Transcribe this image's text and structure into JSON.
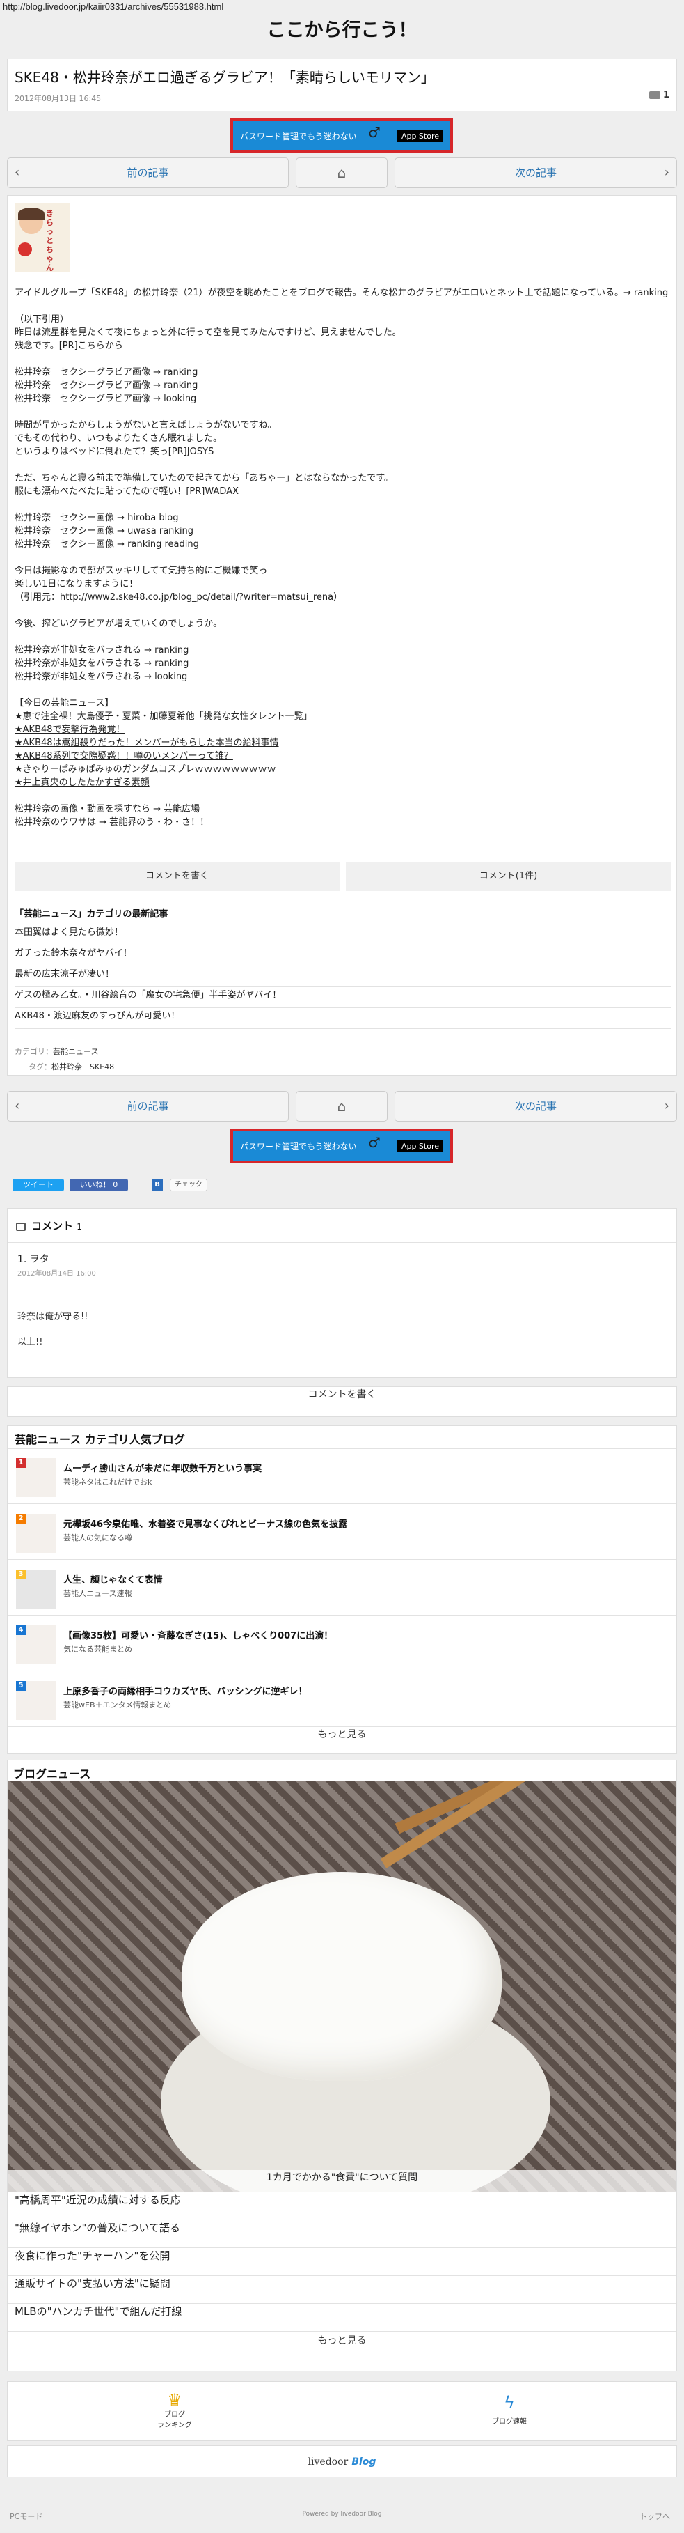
{
  "url": "http://blog.livedoor.jp/kaiir0331/archives/55531988.html",
  "site_title": "ここから行こう！",
  "post": {
    "title": "SKE48・松井玲奈がエロ過ぎるグラビア！「素晴らしいモリマン」",
    "date": "2012年08月13日 16:45",
    "comment_count": "1"
  },
  "banner": {
    "text": "パスワード管理でもう迷わない",
    "store": " App Store"
  },
  "nav": {
    "prev": "前の記事",
    "next": "次の記事"
  },
  "article": {
    "thumb_text": "きらっとちゃん",
    "lines": [
      "アイドルグループ「SKE48」の松井玲奈（21）が夜空を眺めたことをブログで報告。そんな松井のグラビアがエロいとネット上で話題になっている。→ ranking",
      "",
      "（以下引用）",
      "昨日は流星群を見たくて夜にちょっと外に行って空を見てみたんですけど、見えませんでした。",
      "残念です。[PR]こちらから",
      "",
      "松井玲奈　セクシーグラビア画像 → ranking",
      "松井玲奈　セクシーグラビア画像 → ranking",
      "松井玲奈　セクシーグラビア画像 → looking",
      "",
      "時間が早かったからしょうがないと言えばしょうがないですね。",
      "でもその代わり、いつもよりたくさん眠れました。",
      "というよりはベッドに倒れたて？笑っ[PR]JOSYS",
      "",
      "ただ、ちゃんと寝る前まで準備していたので起きてから「あちゃー」とはならなかったです。",
      "服にも漂布べたべたに貼ってたので軽い！[PR]WADAX",
      "",
      "松井玲奈　セクシー画像 → hiroba blog",
      "松井玲奈　セクシー画像 → uwasa ranking",
      "松井玲奈　セクシー画像 → ranking reading",
      "",
      "今日は撮影なので部がスッキリしてて気持ち的にご機嫌で笑っ",
      "楽しい1日になりますように！",
      "（引用元：http://www2.ske48.co.jp/blog_pc/detail/?writer=matsui_rena）",
      "",
      "今後、搾どいグラビアが増えていくのでしょうか。",
      "",
      "松井玲奈が非処女をバラされる → ranking",
      "松井玲奈が非処女をバラされる → ranking",
      "松井玲奈が非処女をバラされる → looking",
      "",
      "【今日の芸能ニュース】",
      "★恵で注全裸！大島優子・夏菜・加藤夏希他「挑発な女性タレント一覧」",
      "★AKB48で妄撃行為発覚！",
      "★AKB48は嵩組殺りだった！メンバーがもらした本当の給料事情",
      "★AKB48系列で交際疑惑！！噂のいメンバーって誰？",
      "★きゃりーぱみゅぱみゅのガンダムコスプレｗｗｗｗｗｗｗｗｗ",
      "★井上真央のしたたかすぎる素顔",
      "",
      "松井玲奈の画像・動画を探すなら → 芸能広場",
      "松井玲奈のウワサは → 芸能界のう・わ・さ！！"
    ]
  },
  "comment_bar": {
    "write": "コメントを書く",
    "count": "コメント(1件)"
  },
  "related": {
    "heading": "「芸能ニュース」カテゴリの最新記事",
    "items": [
      "本田翼はよく見たら微妙！",
      "ガチった鈴木奈々がヤバイ！",
      "最新の広末涼子が凄い！",
      "ゲスの極み乙女。・川谷絵音の「魔女の宅急便」半手姿がヤバイ！",
      "AKB48・渡辺麻友のすっぴんが可愛い！"
    ]
  },
  "meta": {
    "category_label": "カテゴリ：",
    "category": "芸能ニュース",
    "tag_label": "タグ：",
    "tags": "松井玲奈　SKE48"
  },
  "social": {
    "tweet": "ツイート",
    "like": "いいね！ 0",
    "check": "チェック"
  },
  "comments": {
    "heading": "コメント",
    "count": "1",
    "author": "1. ヲタ",
    "date": "2012年08月14日 16:00",
    "body1": "玲奈は俺が守る!!",
    "body2": "以上!!",
    "write": "コメントを書く"
  },
  "ranking": {
    "heading": "芸能ニュース カテゴリ人気ブログ",
    "items": [
      {
        "num": "1",
        "title": "ムーディ勝山さんが未だに年収数千万という事実",
        "sub": "芸能ネタはこれだけでおk",
        "color": "#d32f2f"
      },
      {
        "num": "2",
        "title": "元欅坂46今泉佑唯、水着姿で見事なくびれとビーナス線の色気を披露",
        "sub": "芸能人の気になる噂",
        "color": "#f57c00"
      },
      {
        "num": "3",
        "title": "人生、顔じゃなくて表情",
        "sub": "芸能人ニュース速報",
        "color": "#fbc02d"
      },
      {
        "num": "4",
        "title": "【画像35枚】可愛い・斉藤なぎさ(15)、しゃべくり007に出演！",
        "sub": "気になる芸能まとめ",
        "color": "#1976d2"
      },
      {
        "num": "5",
        "title": "上原多香子の両縁相手コウカズヤ氏、バッシングに逆ギレ！",
        "sub": "芸能wEB＋エンタメ情報まとめ",
        "color": "#1976d2"
      }
    ],
    "more": "もっと見る"
  },
  "blog_news": {
    "heading": "ブログニュース",
    "caption": "1カ月でかかる\"食費\"について質問",
    "items": [
      "\"高橋周平\"近況の成績に対する反応",
      "\"無線イヤホン\"の普及について語る",
      "夜食に作った\"チャーハン\"を公開",
      "通販サイトの\"支払い方法\"に疑問",
      "MLBの\"ハンカチ世代\"で組んだ打線"
    ],
    "more": "もっと見る"
  },
  "footer": {
    "ranking1": "ブログ",
    "ranking2": "ランキング",
    "news": "ブログ速報",
    "logo1": "livedoor",
    "logo2": "Blog",
    "pc": "PCモード",
    "powered": "Powered by livedoor Blog",
    "top": "トップへ"
  }
}
